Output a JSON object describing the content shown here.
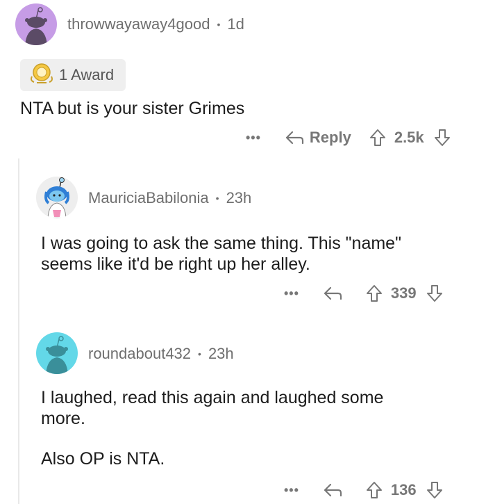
{
  "comments": [
    {
      "username": "throwwayaway4good",
      "age": "1d",
      "award_label": "1 Award",
      "body": [
        "NTA but is your sister Grimes"
      ],
      "more": "•••",
      "reply_label": "Reply",
      "score": "2.5k",
      "avatar_color": "#c69ce6"
    },
    {
      "username": "MauriciaBabilonia",
      "age": "23h",
      "body": [
        "I was going to ask the same thing. This \"name\"",
        "seems like it'd be right up her alley."
      ],
      "more": "•••",
      "score": "339",
      "avatar_color": "#eeeeee"
    },
    {
      "username": "roundabout432",
      "age": "23h",
      "body": [
        "I laughed, read this again and laughed some",
        "more.",
        "Also OP is NTA."
      ],
      "more": "•••",
      "score": "136",
      "avatar_color": "#63d8e8"
    }
  ],
  "icons": {
    "award": "award-medal-icon",
    "reply": "reply-arrow-icon",
    "upvote": "upvote-arrow-icon",
    "downvote": "downvote-arrow-icon",
    "more": "more-options-icon"
  }
}
